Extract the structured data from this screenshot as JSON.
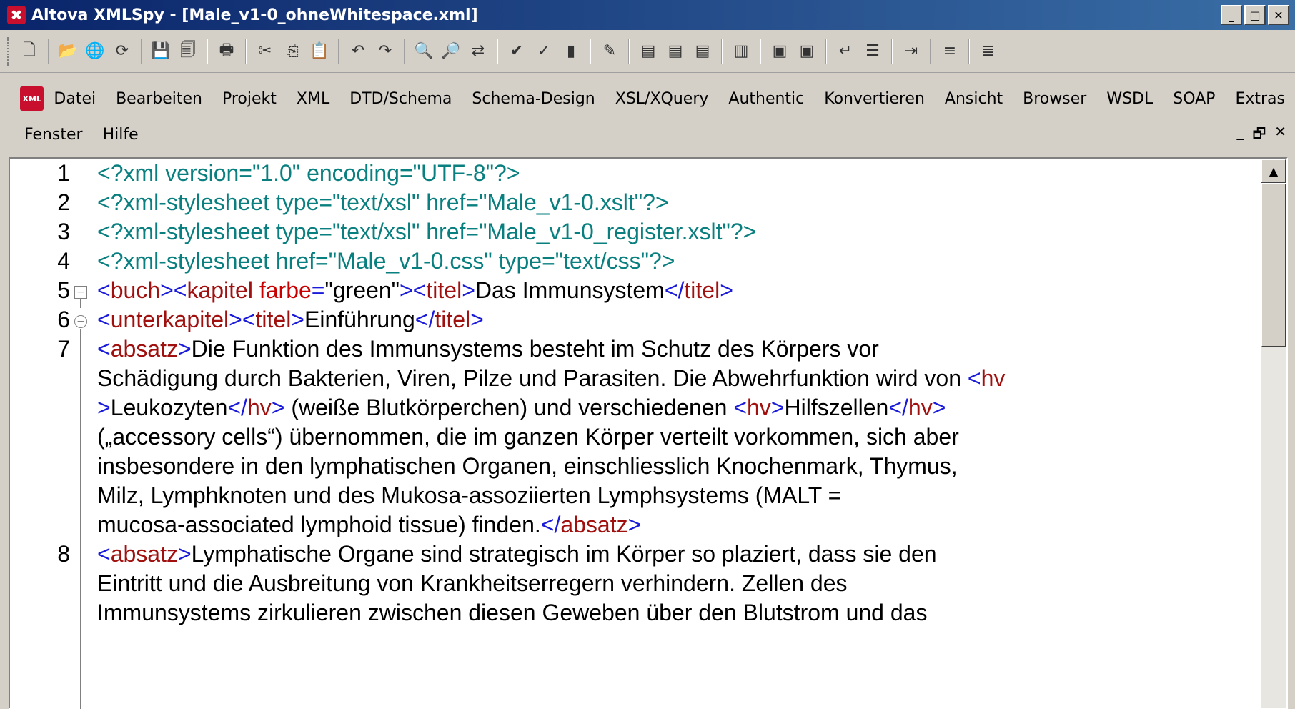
{
  "window": {
    "title": "Altova XMLSpy - [Male_v1-0_ohneWhitespace.xml]",
    "minimize": "_",
    "maximize": "□",
    "close": "✕"
  },
  "toolbar": {
    "icons": [
      "new-icon",
      "open-icon",
      "open-url-icon",
      "reload-icon",
      "save-icon",
      "save-all-icon",
      "print-icon",
      "cut-icon",
      "copy-icon",
      "paste-icon",
      "undo-icon",
      "redo-icon",
      "find-icon",
      "find-next-icon",
      "replace-icon",
      "check-wellformed-icon",
      "validate-icon",
      "insert-icon",
      "spellcheck-icon",
      "xsl-icon",
      "fo-icon",
      "xq-icon",
      "grid-view-icon",
      "dtd-icon",
      "file-icon",
      "wrap-icon",
      "pretty-print-icon",
      "indent-icon",
      "xpath-icon",
      "text-icon"
    ]
  },
  "menu": {
    "row1": [
      "Datei",
      "Bearbeiten",
      "Projekt",
      "XML",
      "DTD/Schema",
      "Schema-Design",
      "XSL/XQuery",
      "Authentic",
      "Konvertieren",
      "Ansicht",
      "Browser",
      "WSDL",
      "SOAP",
      "Extras"
    ],
    "row2": [
      "Fenster",
      "Hilfe"
    ],
    "mdi_min": "_",
    "mdi_restore": "🗗",
    "mdi_close": "✕"
  },
  "editor": {
    "line_numbers": [
      "1",
      "2",
      "3",
      "4",
      "5",
      "6",
      "7",
      "8"
    ],
    "lines": {
      "l1": "<?xml version=\"1.0\" encoding=\"UTF-8\"?>",
      "l2": "<?xml-stylesheet type=\"text/xsl\" href=\"Male_v1-0.xslt\"?>",
      "l3": "<?xml-stylesheet type=\"text/xsl\" href=\"Male_v1-0_register.xslt\"?>",
      "l4": "<?xml-stylesheet href=\"Male_v1-0.css\" type=\"text/css\"?>",
      "l5_buch": "buch",
      "l5_kapitel": "kapitel",
      "l5_attr": "farbe",
      "l5_val": "\"green\"",
      "l5_titel": "titel",
      "l5_text": "Das Immunsystem",
      "l6_unterkapitel": "unterkapitel",
      "l6_titel": "titel",
      "l6_text": "Einführung",
      "l7_absatz": "absatz",
      "l7_t1": "Die Funktion des Immunsystems besteht im Schutz des Körpers vor",
      "l7_t2": "Schädigung durch Bakterien, Viren, Pilze und Parasiten. Die Abwehrfunktion wird von ",
      "l7_hv": "hv",
      "l7_t3": "Leukozyten",
      "l7_t4": " (weiße Blutkörperchen) und verschiedenen ",
      "l7_t5": "Hilfszellen",
      "l7_t6": "(„accessory cells“) übernommen, die im ganzen Körper verteilt vorkommen, sich aber",
      "l7_t7": "insbesondere in den lymphatischen Organen, einschliesslich Knochenmark, Thymus,",
      "l7_t8": "Milz, Lymphknoten und des Mukosa-assoziierten Lymphsystems (MALT =",
      "l7_t9": "mucosa-associated lymphoid tissue) finden.",
      "l8_absatz": "absatz",
      "l8_t1": "Lymphatische Organe sind strategisch im Körper so plaziert, dass sie den",
      "l8_t2": "Eintritt und die Ausbreitung von Krankheitserregern verhindern. Zellen des",
      "l8_t3": "Immunsystems zirkulieren zwischen diesen Geweben über den Blutstrom und das"
    }
  }
}
